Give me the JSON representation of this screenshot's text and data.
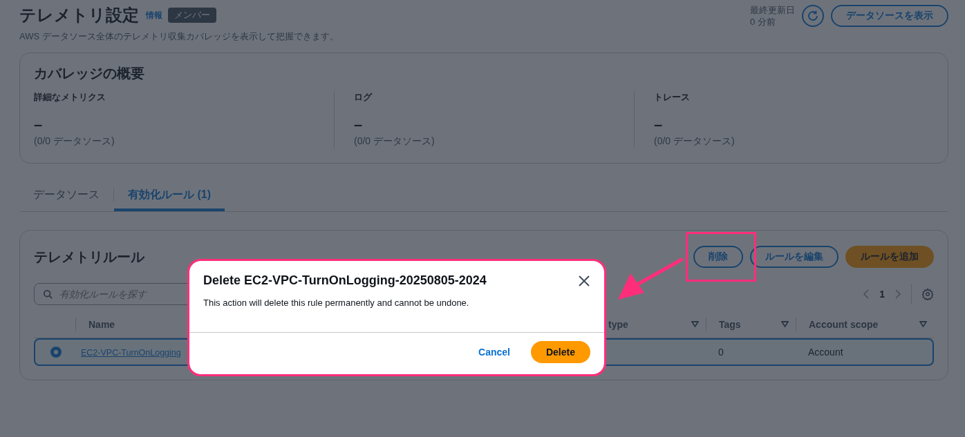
{
  "header": {
    "title": "テレメトリ設定",
    "info_link": "情報",
    "badge": "メンバー",
    "description": "AWS データソース全体のテレメトリ収集カバレッジを表示して把握できます。",
    "last_updated_label": "最終更新日",
    "last_updated_value": "0 分前",
    "view_button": "データソースを表示"
  },
  "coverage": {
    "title": "カバレッジの概要",
    "metrics": [
      {
        "label": "詳細なメトリクス",
        "value": "–",
        "detail": "(0/0 データソース)"
      },
      {
        "label": "ログ",
        "value": "–",
        "detail": "(0/0 データソース)"
      },
      {
        "label": "トレース",
        "value": "–",
        "detail": "(0/0 データソース)"
      }
    ]
  },
  "tabs": [
    {
      "label": "データソース",
      "selected": false
    },
    {
      "label": "有効化ルール (1)",
      "selected": true
    }
  ],
  "rules": {
    "title": "テレメトリルール",
    "buttons": [
      {
        "label": "削除",
        "kind": "normal"
      },
      {
        "label": "ルールを編集",
        "kind": "normal"
      },
      {
        "label": "ルールを追加",
        "kind": "primary"
      }
    ],
    "search": {
      "placeholder": "有効化ルールを探す"
    },
    "pagination": {
      "page": "1"
    },
    "columns": [
      {
        "label": "Name"
      },
      {
        "label": "type",
        "sortable": true
      },
      {
        "label": "Tags",
        "sortable": true
      },
      {
        "label": "Account scope",
        "sortable": true
      }
    ],
    "rows": [
      {
        "selected": true,
        "name": "EC2-VPC-TurnOnLogging",
        "tags": "0",
        "account_scope": "Account"
      }
    ]
  },
  "modal": {
    "title": "Delete EC2-VPC-TurnOnLogging-20250805-2024",
    "body": "This action will delete this rule permanently and cannot be undone.",
    "cancel": "Cancel",
    "confirm": "Delete"
  }
}
